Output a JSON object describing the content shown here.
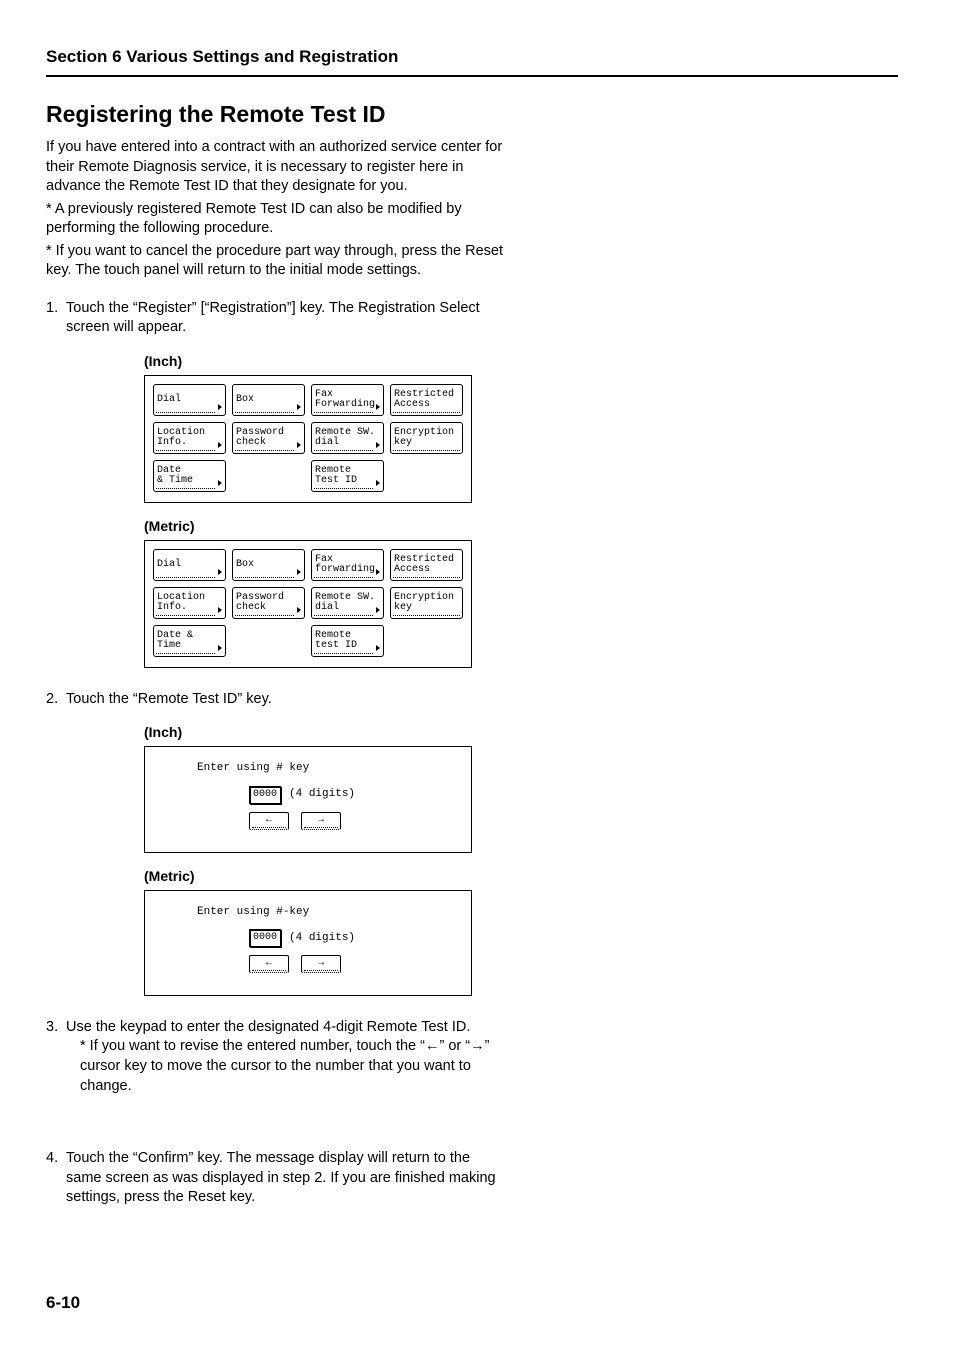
{
  "header": {
    "section": "Section 6  Various Settings and Registration"
  },
  "title": "Registering the Remote Test ID",
  "intro": "If you have entered into a contract with an authorized service center for their Remote Diagnosis service, it is necessary to register here in advance the Remote Test ID that they designate for you.",
  "notes": [
    "* A previously registered Remote Test ID can also be modified by performing the following procedure.",
    "* If you want to cancel the procedure part way through, press the Reset key. The touch panel will return to the initial mode settings."
  ],
  "steps": {
    "s1": {
      "num": "1.",
      "text": "Touch the “Register” [“Registration”] key. The Registration Select screen will appear."
    },
    "s2": {
      "num": "2.",
      "text": "Touch the “Remote Test ID” key."
    },
    "s3": {
      "num": "3.",
      "text": "Use the keypad to enter the designated 4-digit Remote Test ID.",
      "sub": "* If you want to revise the entered number, touch the “←” or “→” cursor key to move the cursor to the number that you want to change."
    },
    "s4": {
      "num": "4.",
      "text": "Touch the “Confirm” key. The message display will return to the same screen as was displayed in step 2. If you are finished making settings, press the Reset key."
    }
  },
  "labels": {
    "inch": "(Inch)",
    "metric": "(Metric)"
  },
  "grid_inch": {
    "r1": [
      {
        "l1": "Dial",
        "l2": ""
      },
      {
        "l1": "Box",
        "l2": ""
      },
      {
        "l1": "Fax",
        "l2": "Forwarding"
      },
      {
        "l1": "Restricted",
        "l2": "Access"
      }
    ],
    "r2": [
      {
        "l1": "Location",
        "l2": "Info."
      },
      {
        "l1": "Password",
        "l2": "check"
      },
      {
        "l1": "Remote SW.",
        "l2": "dial"
      },
      {
        "l1": "Encryption",
        "l2": "key"
      }
    ],
    "r3": [
      {
        "l1": "Date",
        "l2": "& Time"
      },
      {
        "l1": "",
        "l2": ""
      },
      {
        "l1": "Remote",
        "l2": "Test ID"
      },
      {
        "l1": "",
        "l2": ""
      }
    ]
  },
  "grid_metric": {
    "r1": [
      {
        "l1": "Dial",
        "l2": ""
      },
      {
        "l1": "Box",
        "l2": ""
      },
      {
        "l1": "Fax",
        "l2": "forwarding"
      },
      {
        "l1": "Restricted",
        "l2": "Access"
      }
    ],
    "r2": [
      {
        "l1": "Location",
        "l2": "Info."
      },
      {
        "l1": "Password",
        "l2": "check"
      },
      {
        "l1": "Remote SW.",
        "l2": "dial"
      },
      {
        "l1": "Encryption",
        "l2": "key"
      }
    ],
    "r3": [
      {
        "l1": "Date &",
        "l2": "Time"
      },
      {
        "l1": "",
        "l2": ""
      },
      {
        "l1": "Remote",
        "l2": "test ID"
      },
      {
        "l1": "",
        "l2": ""
      }
    ]
  },
  "entry_inch": {
    "prompt": "Enter using # key",
    "value": "0000",
    "digits": "(4 digits)"
  },
  "entry_metric": {
    "prompt": "Enter using #-key",
    "value": "0000",
    "digits": "(4 digits)"
  },
  "arrows": {
    "left": "←",
    "right": "→"
  },
  "page": "6-10"
}
